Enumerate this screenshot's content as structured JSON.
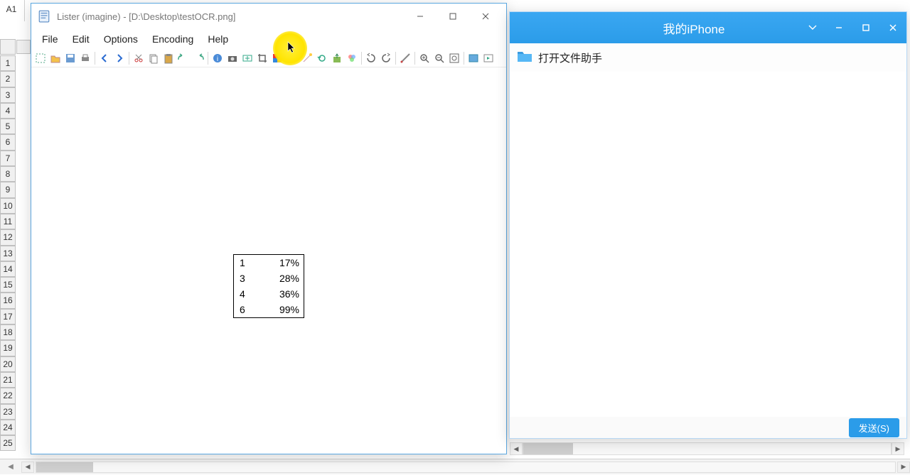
{
  "spreadsheet": {
    "cell_ref": "A1",
    "row_numbers": [
      "1",
      "2",
      "3",
      "4",
      "5",
      "6",
      "7",
      "8",
      "9",
      "10",
      "11",
      "12",
      "13",
      "14",
      "15",
      "16",
      "17",
      "18",
      "19",
      "20",
      "21",
      "22",
      "23",
      "24",
      "25"
    ]
  },
  "lister": {
    "title": "Lister (imagine) - [D:\\Desktop\\testOCR.png]",
    "menu": {
      "file": "File",
      "edit": "Edit",
      "options": "Options",
      "encoding": "Encoding",
      "help": "Help"
    },
    "ocr_table": [
      {
        "col1": "1",
        "col2": "17%"
      },
      {
        "col1": "3",
        "col2": "28%"
      },
      {
        "col1": "4",
        "col2": "36%"
      },
      {
        "col1": "6",
        "col2": "99%"
      }
    ]
  },
  "iphone": {
    "title": "我的iPhone",
    "row_label": "打开文件助手",
    "send_label": "发送(S)"
  },
  "colors": {
    "iphone_blue": "#2b9ce9",
    "highlight_yellow": "#ffe400"
  }
}
